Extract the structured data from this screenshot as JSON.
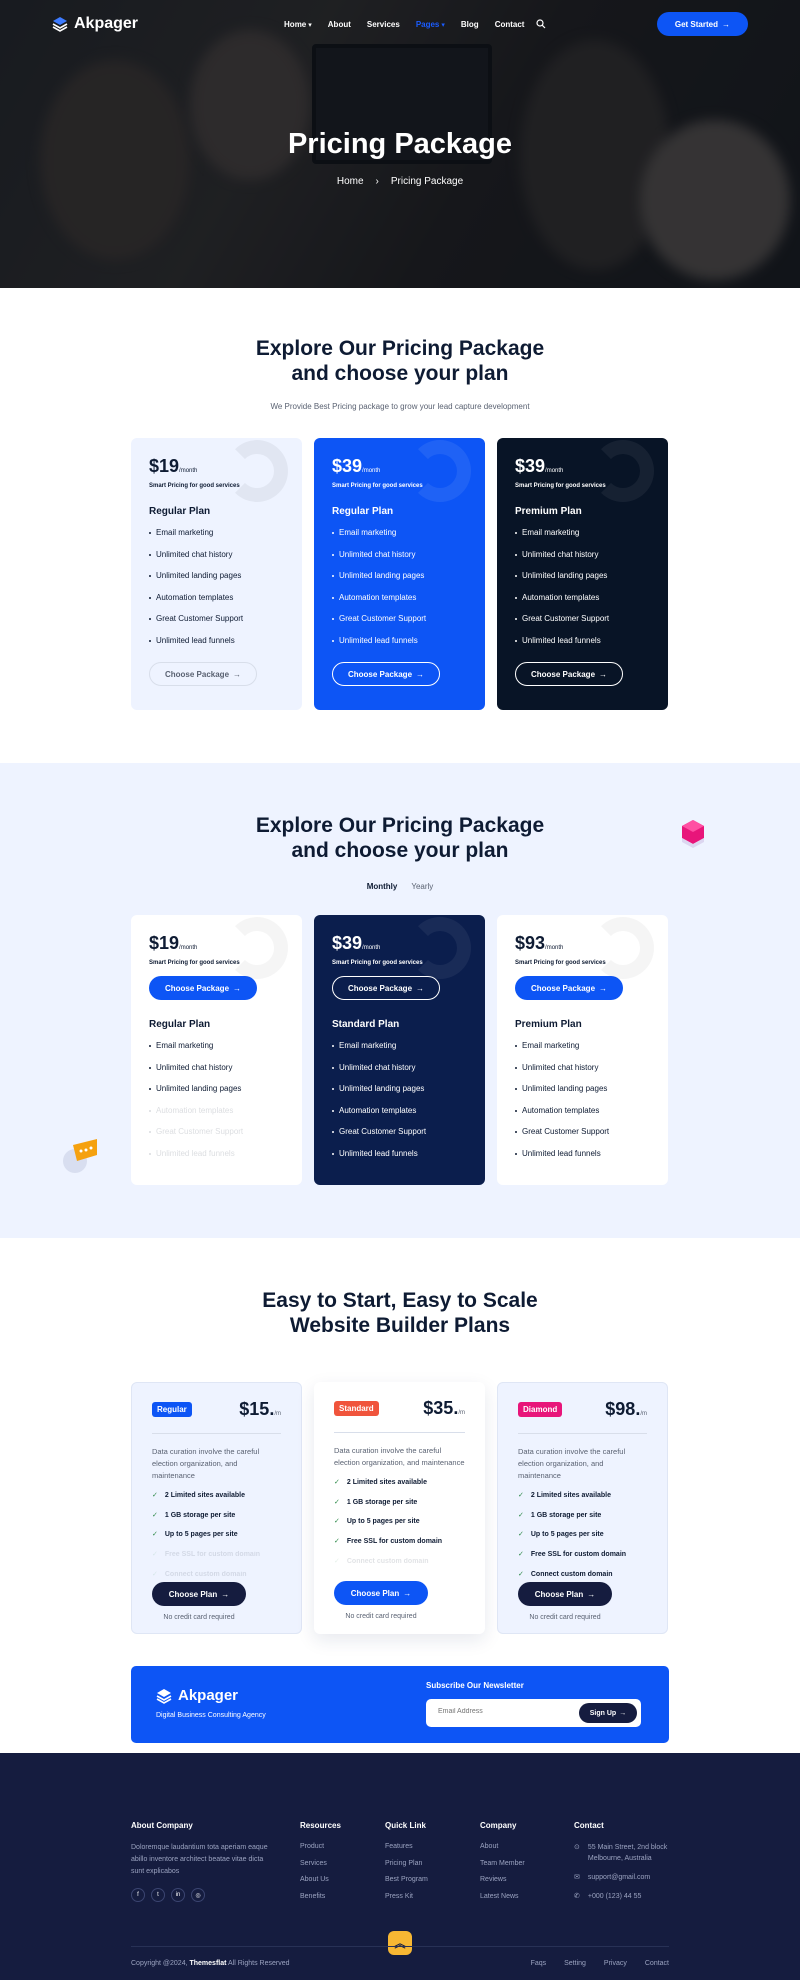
{
  "nav": {
    "brand": "Akpager",
    "items": [
      "Home",
      "About",
      "Services",
      "Pages",
      "Blog",
      "Contact"
    ],
    "active": "Pages",
    "cta": "Get Started"
  },
  "hero": {
    "title": "Pricing Package",
    "breadcrumb_home": "Home",
    "breadcrumb_sep": "›",
    "breadcrumb_current": "Pricing Package"
  },
  "section1": {
    "title_line1": "Explore Our Pricing Package",
    "title_line2": "and choose your plan",
    "subtitle": "We Provide Best Pricing package to grow your lead capture development",
    "cards": [
      {
        "price": "$19",
        "period": "/month",
        "tagline": "Smart Pricing for good services",
        "plan": "Regular Plan",
        "button": "Choose Package"
      },
      {
        "price": "$39",
        "period": "/month",
        "tagline": "Smart Pricing for good services",
        "plan": "Regular Plan",
        "button": "Choose Package"
      },
      {
        "price": "$39",
        "period": "/month",
        "tagline": "Smart Pricing for good services",
        "plan": "Premium Plan",
        "button": "Choose Package"
      }
    ],
    "features": [
      "Email marketing",
      "Unlimited chat history",
      "Unlimited landing pages",
      "Automation templates",
      "Great Customer Support",
      "Unlimited lead funnels"
    ]
  },
  "section2": {
    "title_line1": "Explore Our Pricing Package",
    "title_line2": "and choose your plan",
    "toggle_on": "Monthly",
    "toggle_off": "Yearly",
    "cards": [
      {
        "price": "$19",
        "period": "/month",
        "tagline": "Smart Pricing for good services",
        "plan": "Regular Plan",
        "button": "Choose Package"
      },
      {
        "price": "$39",
        "period": "/month",
        "tagline": "Smart Pricing for good services",
        "plan": "Standard Plan",
        "button": "Choose Package"
      },
      {
        "price": "$93",
        "period": "/month",
        "tagline": "Smart Pricing for good services",
        "plan": "Premium Plan",
        "button": "Choose Package"
      }
    ],
    "features": [
      "Email marketing",
      "Unlimited chat history",
      "Unlimited landing pages",
      "Automation templates",
      "Great Customer Support",
      "Unlimited lead funnels"
    ]
  },
  "section3": {
    "title_line1": "Easy to Start, Easy to Scale",
    "title_line2": "Website Builder Plans",
    "description": "Data curation involve the careful election organization, and maintenance",
    "cards": [
      {
        "tag": "Regular",
        "tag_color": "#0d55f5",
        "price": "$15.",
        "period": "/m",
        "button": "Choose Plan",
        "button_color": "#151c3f",
        "note": "No credit card required"
      },
      {
        "tag": "Standard",
        "tag_color": "#f0543c",
        "price": "$35.",
        "period": "/m",
        "button": "Choose Plan",
        "button_color": "#0d55f5",
        "note": "No credit card required"
      },
      {
        "tag": "Diamond",
        "tag_color": "#e8157a",
        "price": "$98.",
        "period": "/m",
        "button": "Choose Plan",
        "button_color": "#151c3f",
        "note": "No credit card required"
      }
    ],
    "features": [
      "2 Limited sites available",
      "1 GB storage per site",
      "Up to 5 pages per site",
      "Free SSL for custom domain",
      "Connect custom domain"
    ]
  },
  "newsletter": {
    "brand": "Akpager",
    "tagline": "Digital Business Consulting Agency",
    "title": "Subscribe Our Newsletter",
    "placeholder": "Email Address",
    "button": "Sign Up"
  },
  "footer": {
    "about_title": "About Company",
    "about_text": "Doloremque laudantium tota aperiam eaque abillo inventore architect beatae vitae dicta sunt explicabos",
    "resources_title": "Resources",
    "resources": [
      "Product",
      "Services",
      "About Us",
      "Benefits"
    ],
    "quick_title": "Quick Link",
    "quick": [
      "Features",
      "Pricing Plan",
      "Best Program",
      "Press Kit"
    ],
    "company_title": "Company",
    "company": [
      "About",
      "Team Member",
      "Reviews",
      "Latest News"
    ],
    "contact_title": "Contact",
    "address": "55 Main Street, 2nd block Melbourne, Australia",
    "email": "support@gmail.com",
    "phone": "+000 (123) 44 55",
    "copyright_pre": "Copyright @2024,",
    "copyright_brand": "Themesflat",
    "copyright_post": "All Rights Reserved",
    "bottom_links": [
      "Faqs",
      "Setting",
      "Privacy",
      "Contact"
    ]
  }
}
